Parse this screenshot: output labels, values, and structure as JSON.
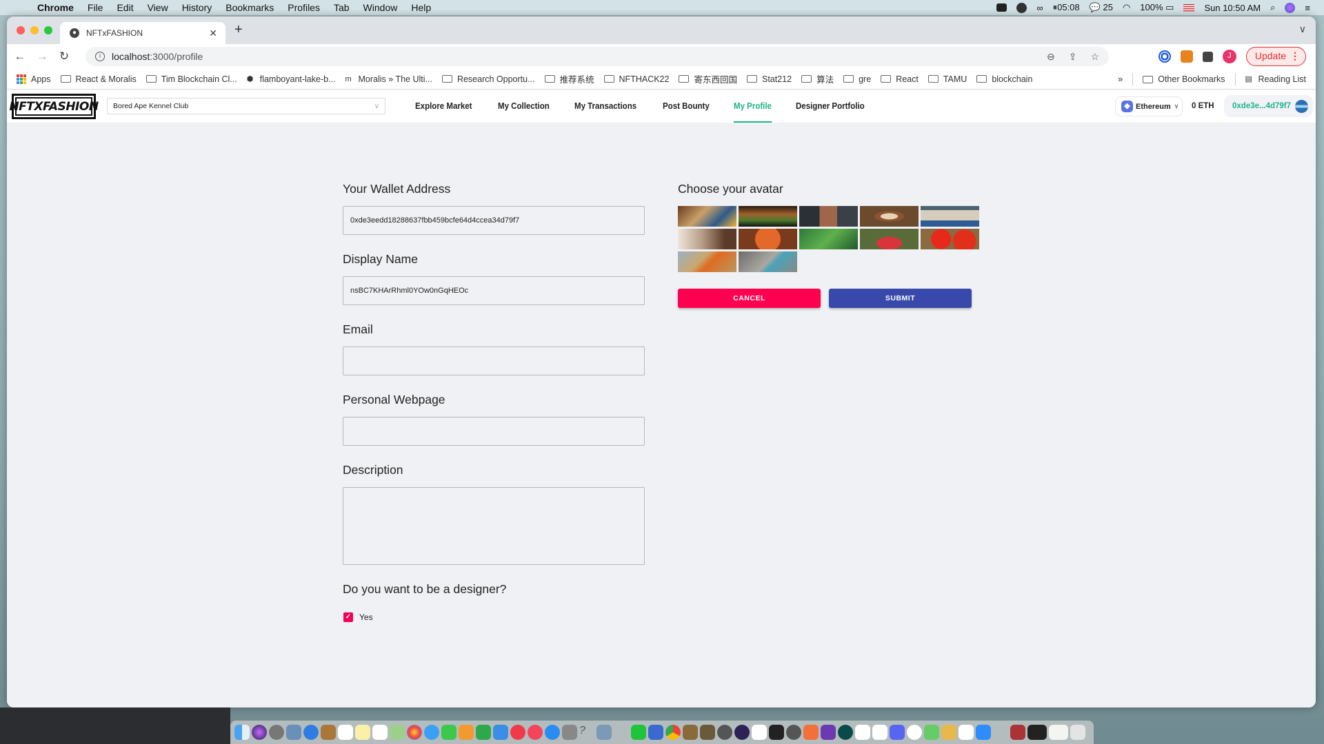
{
  "menubar": {
    "app": "Chrome",
    "items": [
      "File",
      "Edit",
      "View",
      "History",
      "Bookmarks",
      "Profiles",
      "Tab",
      "Window",
      "Help"
    ],
    "status": {
      "timer": "05:08",
      "wechat_count": "25",
      "battery": "100%",
      "datetime": "Sun 10:50 AM"
    }
  },
  "browser": {
    "tab_title": "NFTxFASHION",
    "url_host": "localhost",
    "url_path": ":3000/profile",
    "update_label": "Update",
    "profile_initial": "J",
    "bookmarks": [
      {
        "label": "Apps",
        "icon": "apps-grid-icon"
      },
      {
        "label": "React & Moralis",
        "icon": "folder-icon"
      },
      {
        "label": "Tim Blockchain Cl...",
        "icon": "folder-icon"
      },
      {
        "label": "flamboyant-lake-b...",
        "icon": "cube-icon"
      },
      {
        "label": "Moralis » The Ulti...",
        "icon": "moralis-icon"
      },
      {
        "label": "Research Opportu...",
        "icon": "folder-icon"
      },
      {
        "label": "推荐系统",
        "icon": "folder-icon"
      },
      {
        "label": "NFTHACK22",
        "icon": "folder-icon"
      },
      {
        "label": "寄东西回国",
        "icon": "folder-icon"
      },
      {
        "label": "Stat212",
        "icon": "folder-icon"
      },
      {
        "label": "算法",
        "icon": "folder-icon"
      },
      {
        "label": "gre",
        "icon": "folder-icon"
      },
      {
        "label": "React",
        "icon": "folder-icon"
      },
      {
        "label": "TAMU",
        "icon": "folder-icon"
      },
      {
        "label": "blockchain",
        "icon": "folder-icon"
      }
    ],
    "overflow": "»",
    "other_bookmarks": "Other Bookmarks",
    "reading_list": "Reading List"
  },
  "app": {
    "logo": "NFTXFASHION",
    "collection_select": "Bored Ape Kennel Club",
    "nav": [
      {
        "label": "Explore Market",
        "active": false
      },
      {
        "label": "My Collection",
        "active": false
      },
      {
        "label": "My Transactions",
        "active": false
      },
      {
        "label": "Post Bounty",
        "active": false
      },
      {
        "label": "My Profile",
        "active": true
      },
      {
        "label": "Designer Portfolio",
        "active": false
      }
    ],
    "chain": "Ethereum",
    "balance": "0 ETH",
    "account": "0xde3e...4d79f7",
    "accent": "#21b38c"
  },
  "form": {
    "wallet_label": "Your Wallet Address",
    "wallet_value": "0xde3eedd18288637fbb459bcfe64d4ccea34d79f7",
    "display_label": "Display Name",
    "display_value": "nsBC7KHArRhml0YOw0nGqHEOc",
    "email_label": "Email",
    "email_value": "",
    "webpage_label": "Personal Webpage",
    "webpage_value": "",
    "description_label": "Description",
    "description_value": "",
    "designer_question": "Do you want to be a designer?",
    "designer_option": "Yes",
    "designer_checked": true
  },
  "avatar": {
    "title": "Choose your avatar",
    "images": [
      {
        "subject": "breakfast"
      },
      {
        "subject": "burger"
      },
      {
        "subject": "speaker"
      },
      {
        "subject": "latte"
      },
      {
        "subject": "pillows"
      },
      {
        "subject": "jar"
      },
      {
        "subject": "basketball"
      },
      {
        "subject": "fern"
      },
      {
        "subject": "mushroom"
      },
      {
        "subject": "tomatoes"
      },
      {
        "subject": "starfish"
      },
      {
        "subject": "bicycle"
      }
    ],
    "cancel_label": "CANCEL",
    "submit_label": "SUBMIT",
    "cancel_color": "#ff0050",
    "submit_color": "#3949ab"
  }
}
